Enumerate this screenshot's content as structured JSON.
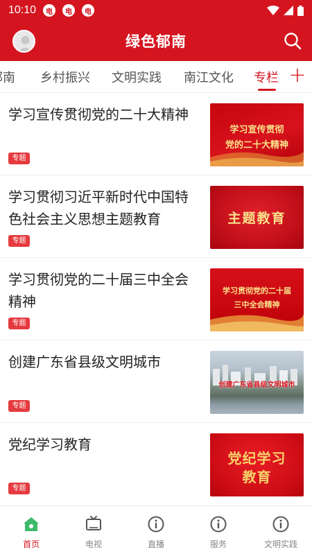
{
  "status_bar": {
    "time": "10:10",
    "badges": [
      "电",
      "电",
      "电"
    ]
  },
  "header": {
    "title": "绿色郁南"
  },
  "tabs": [
    {
      "label": "郁南"
    },
    {
      "label": "乡村振兴"
    },
    {
      "label": "文明实践"
    },
    {
      "label": "南江文化"
    },
    {
      "label": "专栏"
    }
  ],
  "tab_add": "+",
  "items": [
    {
      "title": "学习宣传贯彻党的二十大精神",
      "tag": "专题",
      "thumb_line1": "学习宣传贯彻",
      "thumb_line2": "党的二十大精神"
    },
    {
      "title": "学习贯彻习近平新时代中国特色社会主义思想主题教育",
      "tag": "专题",
      "thumb_line1": "主题教育"
    },
    {
      "title": "学习贯彻党的二十届三中全会精神",
      "tag": "专题",
      "thumb_line1": "学习贯彻党的二十届",
      "thumb_line2": "三中全会精神"
    },
    {
      "title": "创建广东省县级文明城市",
      "tag": "专题",
      "thumb_line1": "创建广东省县级文明城市"
    },
    {
      "title": "党纪学习教育",
      "tag": "专题",
      "thumb_line1": "党纪学习",
      "thumb_line2": "教育"
    }
  ],
  "bottom_nav": [
    {
      "label": "首页",
      "icon": "home-icon"
    },
    {
      "label": "电视",
      "icon": "tv-icon"
    },
    {
      "label": "直播",
      "icon": "info-icon"
    },
    {
      "label": "服务",
      "icon": "info-icon"
    },
    {
      "label": "文明实践",
      "icon": "info-icon"
    }
  ],
  "colors": {
    "brand": "#d4151f",
    "tag": "#e53a3f",
    "home_icon": "#3dbb6b"
  }
}
